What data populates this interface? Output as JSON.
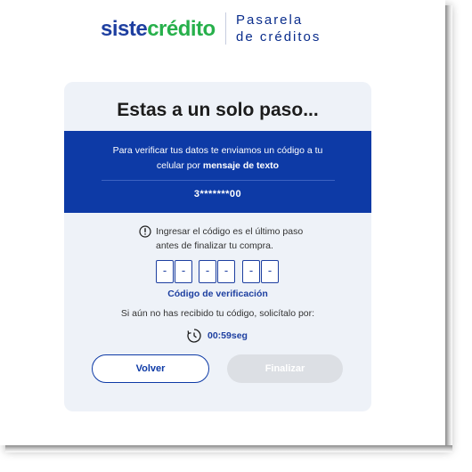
{
  "header": {
    "brand_part1": "siste",
    "brand_part2": "crédito",
    "gateway_line1": "Pasarela",
    "gateway_line2": "de créditos"
  },
  "card": {
    "title": "Estas a un solo paso...",
    "banner_text_line1": "Para verificar tus datos te enviamos un código a tu",
    "banner_text_line2_prefix": "celular por",
    "banner_text_line2_bold": "mensaje de texto",
    "phone_masked": "3*******00",
    "notice_line1": "Ingresar el código es el último paso",
    "notice_line2": "antes de finalizar tu compra.",
    "otp_digits": [
      "-",
      "-",
      "-",
      "-",
      "-",
      "-"
    ],
    "otp_label": "Código de verificación",
    "resend_text": "Si aún no has recibido tu código, solicítalo por:",
    "timer": "00:59seg",
    "back_button": "Volver",
    "finish_button": "Finalizar"
  },
  "colors": {
    "brand_blue": "#1e3fa0",
    "brand_green": "#27b04b",
    "banner_blue": "#0d3aa6",
    "disabled_button": "#dcdfe4"
  },
  "icons": {
    "notice": "info-circle-icon",
    "timer": "stopwatch-icon"
  }
}
